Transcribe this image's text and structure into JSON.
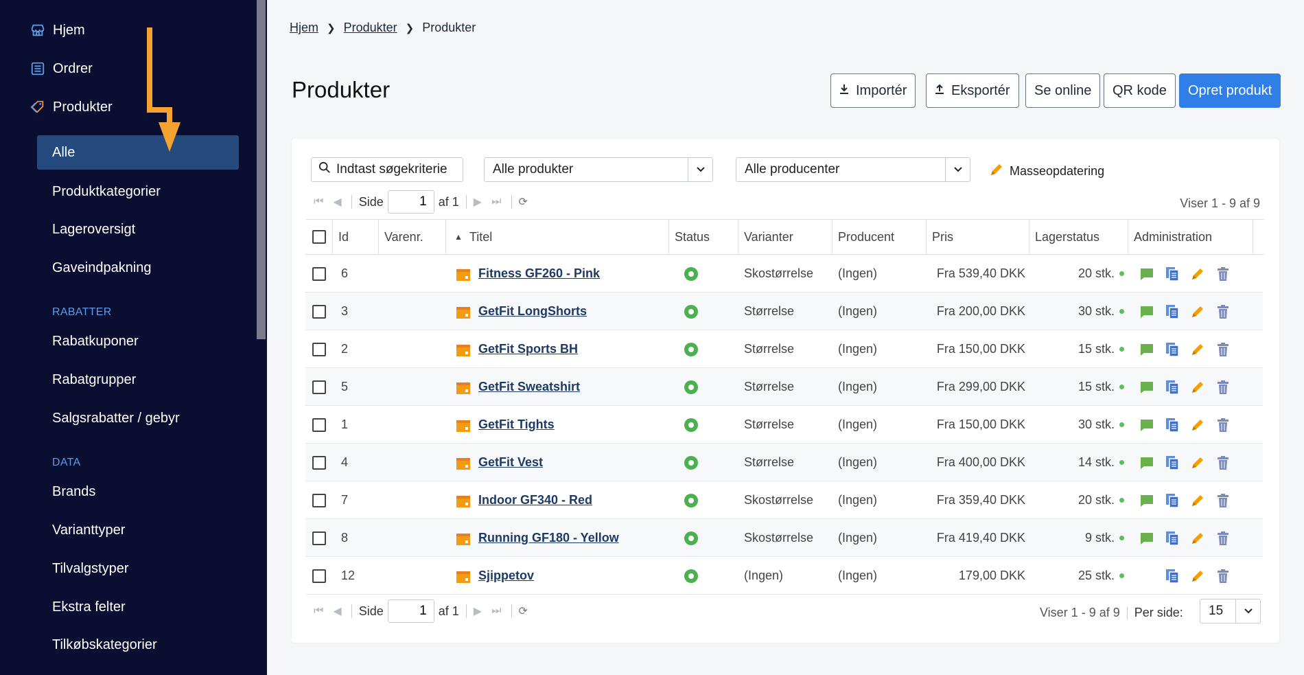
{
  "sidebar": {
    "top_items": [
      {
        "label": "Hjem",
        "icon": "store-icon"
      },
      {
        "label": "Ordrer",
        "icon": "list-icon"
      },
      {
        "label": "Produkter",
        "icon": "tag-icon"
      }
    ],
    "active_sub": "Alle",
    "products_sub": [
      "Produktkategorier",
      "Lageroversigt",
      "Gaveindpakning"
    ],
    "section_rabatter": "RABATTER",
    "rabatter_items": [
      "Rabatkuponer",
      "Rabatgrupper",
      "Salgsrabatter / gebyr"
    ],
    "section_data": "DATA",
    "data_items": [
      "Brands",
      "Varianttyper",
      "Tilvalgstyper",
      "Ekstra felter",
      "Tilkøbskategorier"
    ]
  },
  "breadcrumb": [
    "Hjem",
    "Produkter",
    "Produkter"
  ],
  "page_title": "Produkter",
  "toolbar": {
    "import_label": "Importér",
    "export_label": "Eksportér",
    "online_label": "Se online",
    "qr_label": "QR kode",
    "create_label": "Opret produkt"
  },
  "filters": {
    "search_placeholder": "Indtast søgekriterie",
    "products_select": "Alle produkter",
    "producers_select": "Alle producenter",
    "mass_update": "Masseopdatering"
  },
  "pager": {
    "side_label": "Side",
    "page": "1",
    "of_label": "af 1",
    "showing": "Viser 1 - 9 af 9",
    "per_page_label": "Per side:",
    "per_page": "15"
  },
  "columns": [
    "Id",
    "Varenr.",
    "Titel",
    "Status",
    "Varianter",
    "Producent",
    "Pris",
    "Lagerstatus",
    "Administration"
  ],
  "rows": [
    {
      "id": "6",
      "title": "Fitness GF260 - Pink",
      "variants": "Skostørrelse",
      "producer": "(Ingen)",
      "price": "Fra 539,40 DKK",
      "stock": "20 stk.",
      "comment": true
    },
    {
      "id": "3",
      "title": "GetFit LongShorts",
      "variants": "Størrelse",
      "producer": "(Ingen)",
      "price": "Fra 200,00 DKK",
      "stock": "30 stk.",
      "comment": true
    },
    {
      "id": "2",
      "title": "GetFit Sports BH",
      "variants": "Størrelse",
      "producer": "(Ingen)",
      "price": "Fra 150,00 DKK",
      "stock": "15 stk.",
      "comment": true
    },
    {
      "id": "5",
      "title": "GetFit Sweatshirt",
      "variants": "Størrelse",
      "producer": "(Ingen)",
      "price": "Fra 299,00 DKK",
      "stock": "15 stk.",
      "comment": true
    },
    {
      "id": "1",
      "title": "GetFit Tights",
      "variants": "Størrelse",
      "producer": "(Ingen)",
      "price": "Fra 150,00 DKK",
      "stock": "30 stk.",
      "comment": true
    },
    {
      "id": "4",
      "title": "GetFit Vest",
      "variants": "Størrelse",
      "producer": "(Ingen)",
      "price": "Fra 400,00 DKK",
      "stock": "14 stk.",
      "comment": true
    },
    {
      "id": "7",
      "title": "Indoor GF340 - Red",
      "variants": "Skostørrelse",
      "producer": "(Ingen)",
      "price": "Fra 359,40 DKK",
      "stock": "20 stk.",
      "comment": true
    },
    {
      "id": "8",
      "title": "Running GF180 - Yellow",
      "variants": "Skostørrelse",
      "producer": "(Ingen)",
      "price": "Fra 419,40 DKK",
      "stock": "9 stk.",
      "comment": true
    },
    {
      "id": "12",
      "title": "Sjippetov",
      "variants": "(Ingen)",
      "producer": "(Ingen)",
      "price": "179,00 DKK",
      "stock": "25 stk.",
      "comment": false
    }
  ],
  "colors": {
    "sidebar_bg": "#0a0f32",
    "active_bg": "#254a7e",
    "primary": "#2f7fe6",
    "arrow": "#f5a230",
    "status_green": "#4caf50"
  }
}
